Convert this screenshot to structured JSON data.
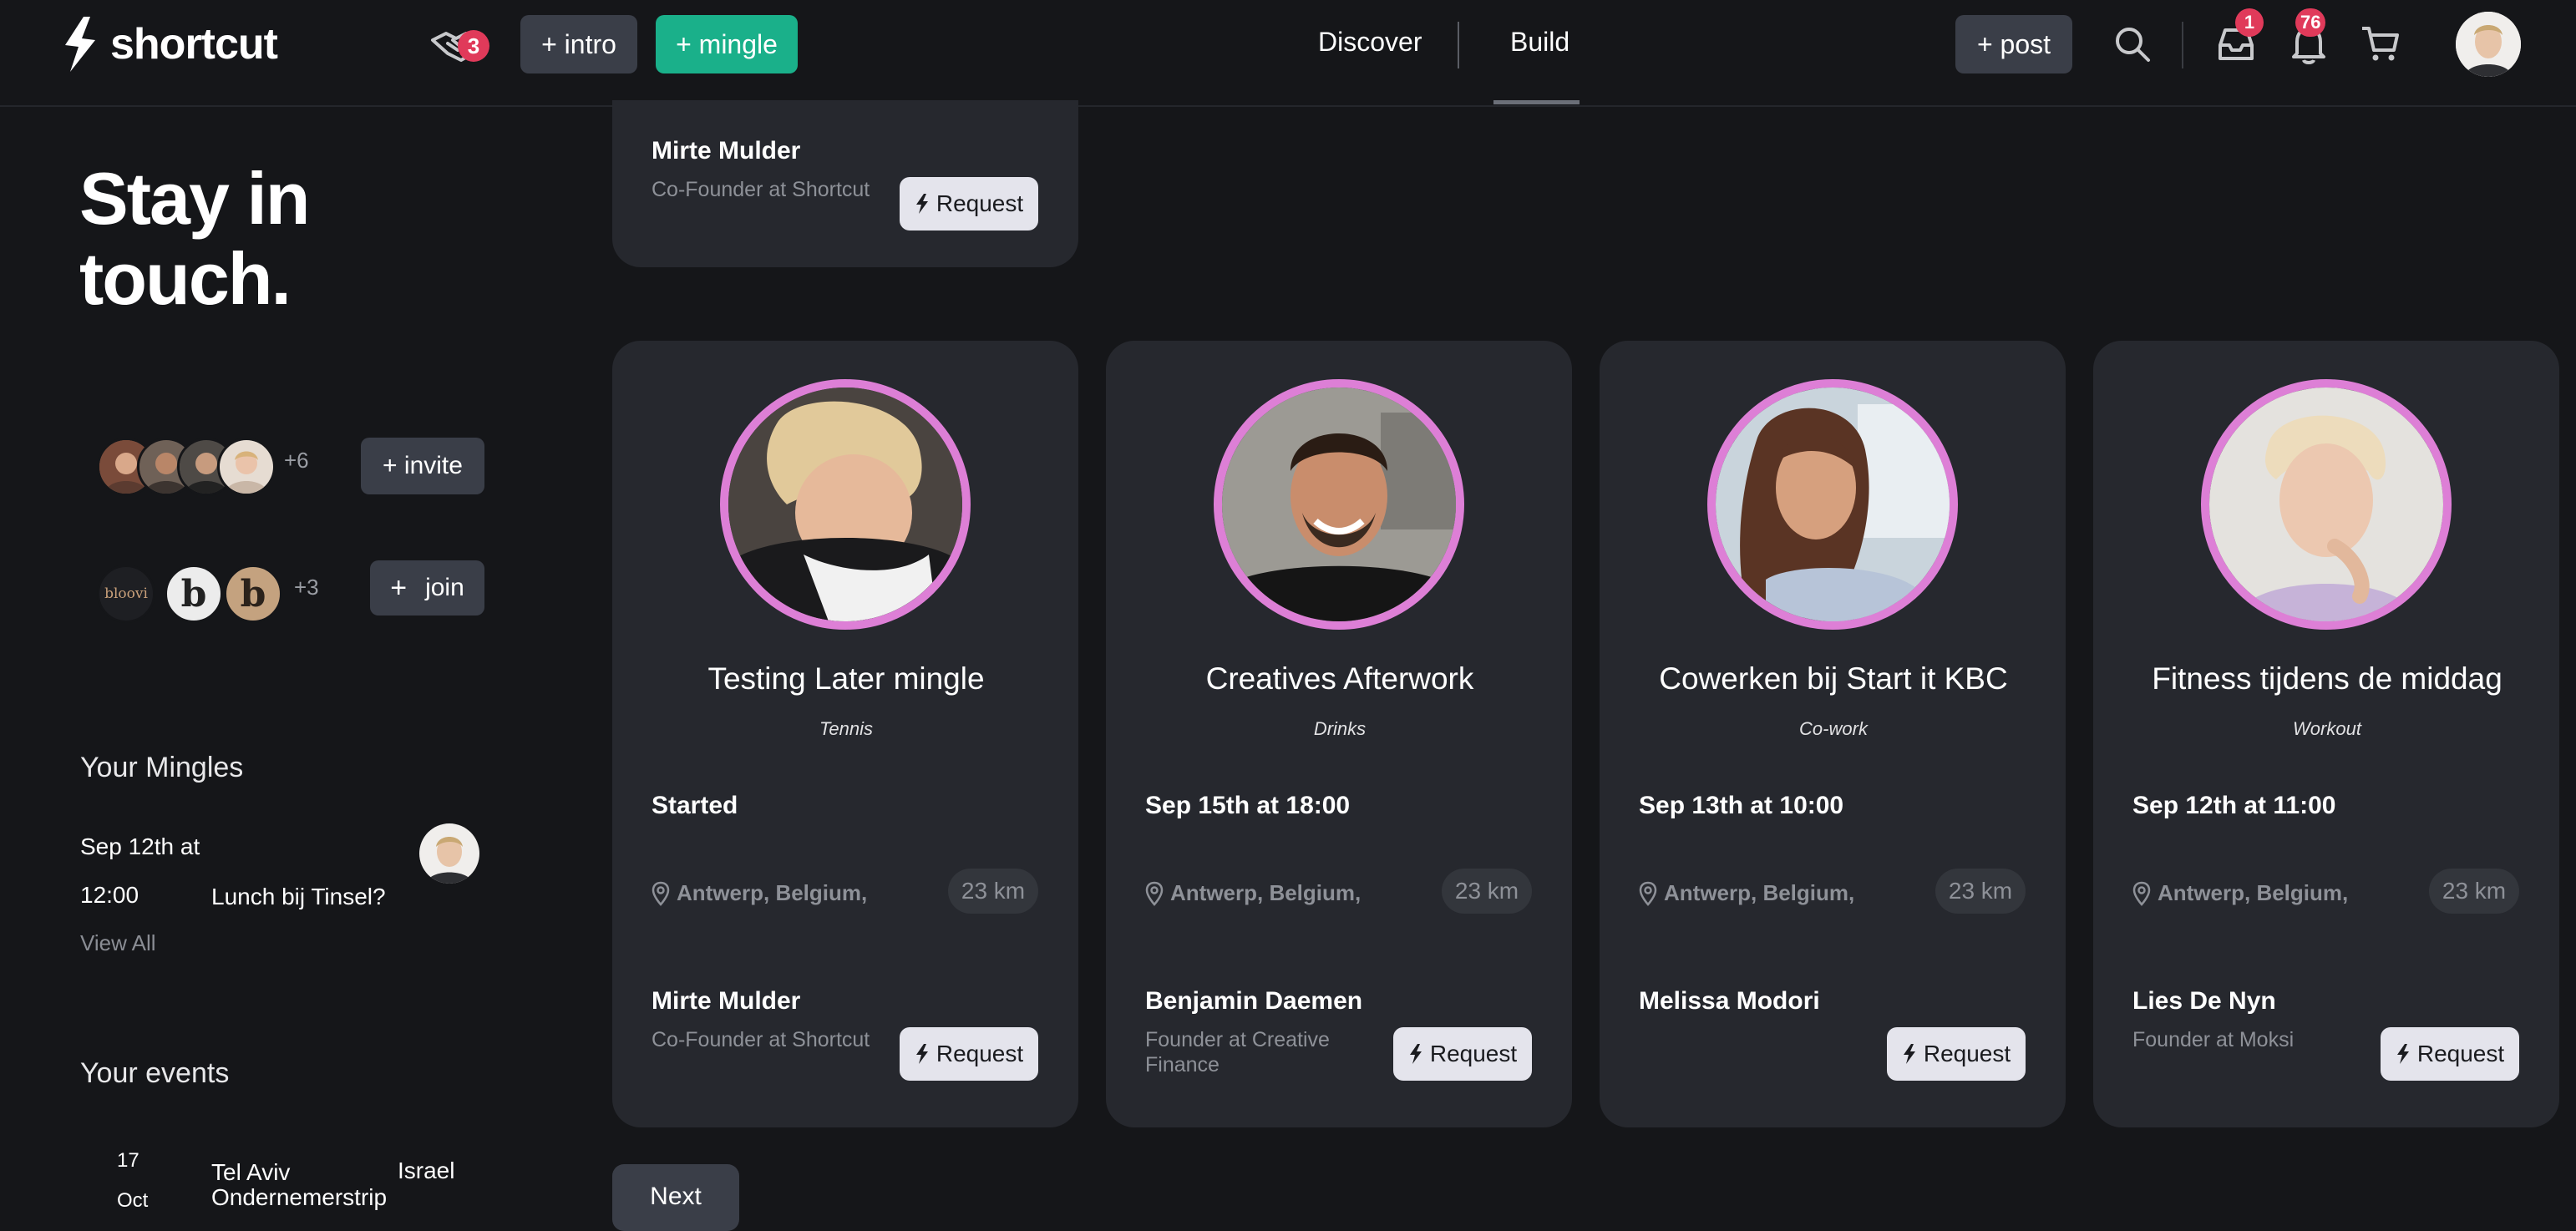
{
  "app": {
    "name": "shortcut"
  },
  "header": {
    "handshake_count": "3",
    "intro_label": "+ intro",
    "mingle_label": "+ mingle",
    "nav_discover": "Discover",
    "nav_build": "Build",
    "post_label": "+ post",
    "inbox_count": "1",
    "notification_count": "76"
  },
  "sidebar": {
    "headline_line1": "Stay in",
    "headline_line2": "touch.",
    "people_more": "+6",
    "invite_label": "+ invite",
    "groups": [
      "bloovi",
      "b",
      "b"
    ],
    "groups_more": "+3",
    "join_label": "join",
    "mingles_title": "Your Mingles",
    "mingle_date_line1": "Sep 12th at",
    "mingle_date_line2": "12:00",
    "mingle_name": "Lunch bij Tinsel?",
    "view_all": "View All",
    "events_title": "Your events",
    "event_day": "17",
    "event_month": "Oct",
    "event_name_line1": "Tel Aviv",
    "event_name_line2": "Ondernemerstrip",
    "event_country": "Israel"
  },
  "top_card": {
    "name": "Mirte Mulder",
    "role": "Co-Founder at Shortcut",
    "request_label": "Request"
  },
  "cards": [
    {
      "title": "Testing Later mingle",
      "category": "Tennis",
      "date": "Started",
      "location": "Antwerp, Belgium,",
      "distance": "23 km",
      "person": "Mirte Mulder",
      "role_line1": "Co-Founder at Shortcut",
      "role_line2": "",
      "request_label": "Request"
    },
    {
      "title": "Creatives Afterwork",
      "category": "Drinks",
      "date": "Sep 15th at 18:00",
      "location": "Antwerp, Belgium,",
      "distance": "23 km",
      "person": "Benjamin Daemen",
      "role_line1": "Founder at Creative",
      "role_line2": "Finance",
      "request_label": "Request"
    },
    {
      "title": "Cowerken bij Start it KBC",
      "category": "Co-work",
      "date": "Sep 13th at 10:00",
      "location": "Antwerp, Belgium,",
      "distance": "23 km",
      "person": "Melissa Modori",
      "role_line1": "",
      "role_line2": "",
      "request_label": "Request"
    },
    {
      "title": "Fitness tijdens de middag",
      "category": "Workout",
      "date": "Sep 12th at 11:00",
      "location": "Antwerp, Belgium,",
      "distance": "23 km",
      "person": "Lies De Nyn",
      "role_line1": "Founder at Moksi",
      "role_line2": "",
      "request_label": "Request"
    }
  ],
  "pagination": {
    "next_label": "Next"
  },
  "colors": {
    "background": "#151619",
    "card": "#26282e",
    "accent_green": "#1ab08a",
    "ring_pink": "#dd7fd6",
    "badge_red": "#e03a5a"
  }
}
